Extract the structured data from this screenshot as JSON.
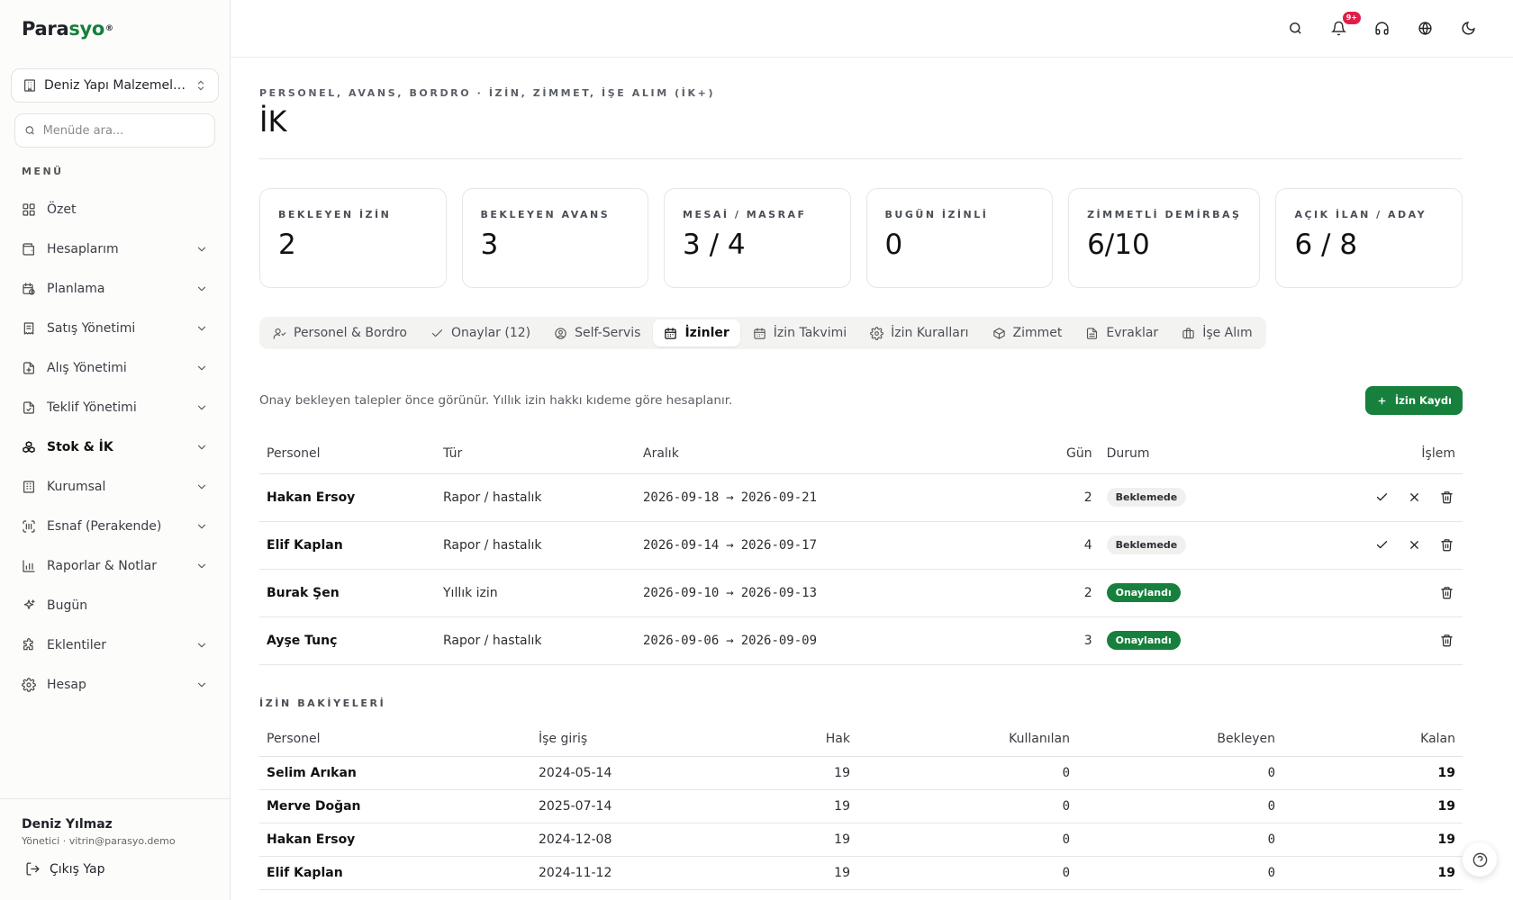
{
  "brand": {
    "part1": "Para",
    "part2": "syo",
    "mark": "®"
  },
  "sidebar": {
    "company": "Deniz Yapı Malzemeleri...",
    "search_placeholder": "Menüde ara...",
    "menu_title": "MENÜ",
    "items": [
      {
        "label": "Özet",
        "icon": "grid-icon",
        "chevron": false
      },
      {
        "label": "Hesaplarım",
        "icon": "wallet-icon",
        "chevron": true
      },
      {
        "label": "Planlama",
        "icon": "calendar-clock-icon",
        "chevron": true
      },
      {
        "label": "Satış Yönetimi",
        "icon": "receipt-icon",
        "chevron": true
      },
      {
        "label": "Alış Yönetimi",
        "icon": "file-plus-icon",
        "chevron": true
      },
      {
        "label": "Teklif Yönetimi",
        "icon": "file-check-icon",
        "chevron": true
      },
      {
        "label": "Stok & İK",
        "icon": "boxes-icon",
        "chevron": true,
        "active": true
      },
      {
        "label": "Kurumsal",
        "icon": "building-icon",
        "chevron": true
      },
      {
        "label": "Esnaf (Perakende)",
        "icon": "scan-icon",
        "chevron": true
      },
      {
        "label": "Raporlar & Notlar",
        "icon": "bar-chart-icon",
        "chevron": true
      },
      {
        "label": "Bugün",
        "icon": "sparkles-icon",
        "chevron": false
      },
      {
        "label": "Eklentiler",
        "icon": "puzzle-icon",
        "chevron": true
      },
      {
        "label": "Hesap",
        "icon": "gear-icon",
        "chevron": true
      }
    ],
    "user": {
      "name": "Deniz Yılmaz",
      "meta": "Yönetici · vitrin@parasyo.demo"
    },
    "logout": "Çıkış Yap"
  },
  "topbar": {
    "notification_badge": "9+"
  },
  "page": {
    "eyebrow": "PERSONEL, AVANS, BORDRO · İZİN, ZİMMET, İŞE ALIM (İK+)",
    "title": "İK"
  },
  "stats": [
    {
      "label": "BEKLEYEN İZİN",
      "value": "2"
    },
    {
      "label": "BEKLEYEN AVANS",
      "value": "3"
    },
    {
      "label": "MESAİ / MASRAF",
      "value": "3 / 4"
    },
    {
      "label": "BUGÜN İZİNLİ",
      "value": "0"
    },
    {
      "label": "ZİMMETLİ DEMİRBAŞ",
      "value": "6/10"
    },
    {
      "label": "AÇIK İLAN / ADAY",
      "value": "6 / 8"
    }
  ],
  "tabs": [
    {
      "label": "Personel & Bordro",
      "icon": "users-icon"
    },
    {
      "label": "Onaylar (12)",
      "icon": "check-icon"
    },
    {
      "label": "Self-Servis",
      "icon": "user-circle-icon"
    },
    {
      "label": "İzinler",
      "icon": "calendar-icon",
      "active": true
    },
    {
      "label": "İzin Takvimi",
      "icon": "calendar-icon"
    },
    {
      "label": "İzin Kuralları",
      "icon": "gear-icon"
    },
    {
      "label": "Zimmet",
      "icon": "package-icon"
    },
    {
      "label": "Evraklar",
      "icon": "file-icon"
    },
    {
      "label": "İşe Alım",
      "icon": "briefcase-icon"
    }
  ],
  "leave": {
    "hint": "Onay bekleyen talepler önce görünür. Yıllık izin hakkı kıdeme göre hesaplanır.",
    "add_button": "İzin Kaydı",
    "columns": {
      "person": "Personel",
      "type": "Tür",
      "range": "Aralık",
      "days": "Gün",
      "status": "Durum",
      "action": "İşlem"
    },
    "arrow": "→",
    "rows": [
      {
        "person": "Hakan Ersoy",
        "type": "Rapor / hastalık",
        "start": "2026-09-18",
        "end": "2026-09-21",
        "days": "2",
        "status": "Beklemede",
        "pending": true
      },
      {
        "person": "Elif Kaplan",
        "type": "Rapor / hastalık",
        "start": "2026-09-14",
        "end": "2026-09-17",
        "days": "4",
        "status": "Beklemede",
        "pending": true
      },
      {
        "person": "Burak Şen",
        "type": "Yıllık izin",
        "start": "2026-09-10",
        "end": "2026-09-13",
        "days": "2",
        "status": "Onaylandı",
        "pending": false
      },
      {
        "person": "Ayşe Tunç",
        "type": "Rapor / hastalık",
        "start": "2026-09-06",
        "end": "2026-09-09",
        "days": "3",
        "status": "Onaylandı",
        "pending": false
      }
    ]
  },
  "balances": {
    "title": "İZİN BAKİYELERİ",
    "columns": {
      "person": "Personel",
      "start": "İşe giriş",
      "entitled": "Hak",
      "used": "Kullanılan",
      "pending": "Bekleyen",
      "remaining": "Kalan"
    },
    "rows": [
      {
        "person": "Selim Arıkan",
        "start": "2024-05-14",
        "entitled": "19",
        "used": "0",
        "pending": "0",
        "remaining": "19"
      },
      {
        "person": "Merve Doğan",
        "start": "2025-07-14",
        "entitled": "19",
        "used": "0",
        "pending": "0",
        "remaining": "19"
      },
      {
        "person": "Hakan Ersoy",
        "start": "2024-12-08",
        "entitled": "19",
        "used": "0",
        "pending": "0",
        "remaining": "19"
      },
      {
        "person": "Elif Kaplan",
        "start": "2024-11-12",
        "entitled": "19",
        "used": "0",
        "pending": "0",
        "remaining": "19"
      }
    ]
  },
  "colors": {
    "brand_green": "#16803c",
    "badge_red": "#e11d48",
    "pending_bg": "#f0f0ef"
  }
}
